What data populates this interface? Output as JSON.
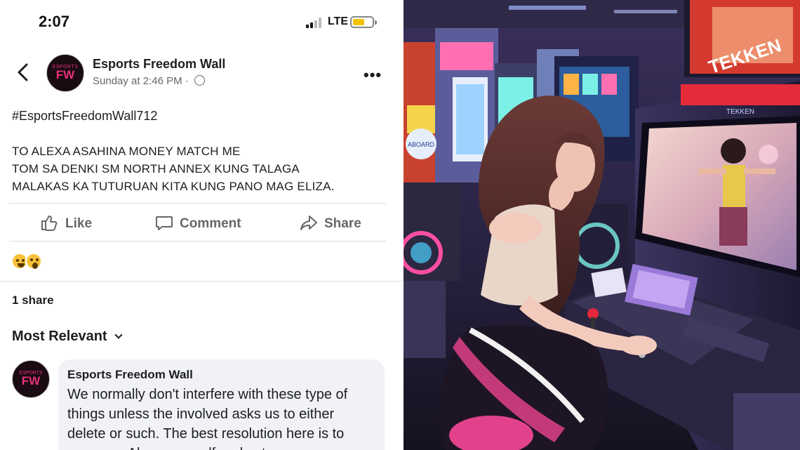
{
  "status_bar": {
    "time": "2:07",
    "network": "LTE"
  },
  "post": {
    "page_name": "Esports Freedom Wall",
    "avatar_text_small": "ESPORTS",
    "avatar_text": "FW",
    "timestamp": "Sunday at 2:46 PM ·",
    "hashtag": "#EsportsFreedomWall712",
    "text_lines": [
      "TO ALEXA ASAHINA MONEY MATCH ME",
      "TOM SA DENKI SM NORTH ANNEX KUNG TALAGA",
      "MALAKAS KA TUTURUAN KITA KUNG PANO MAG ELIZA."
    ]
  },
  "actions": {
    "like": "Like",
    "comment": "Comment",
    "share": "Share"
  },
  "engagement": {
    "shares": "1 share",
    "sort": "Most Relevant"
  },
  "comment": {
    "author": "Esports Freedom Wall",
    "text": "We normally don't interfere with these type of things unless the involved asks us to either delete or such. The best resolution here is to message Alexa yourself and set"
  },
  "photo": {
    "machine_logo": "TEKKEN",
    "cabinet_label": "TEKKEN",
    "sign_text": "ABOARD"
  },
  "colors": {
    "accent_pink": "#e6317a",
    "fb_gray": "#65676b",
    "bubble": "#f0f2f5"
  }
}
